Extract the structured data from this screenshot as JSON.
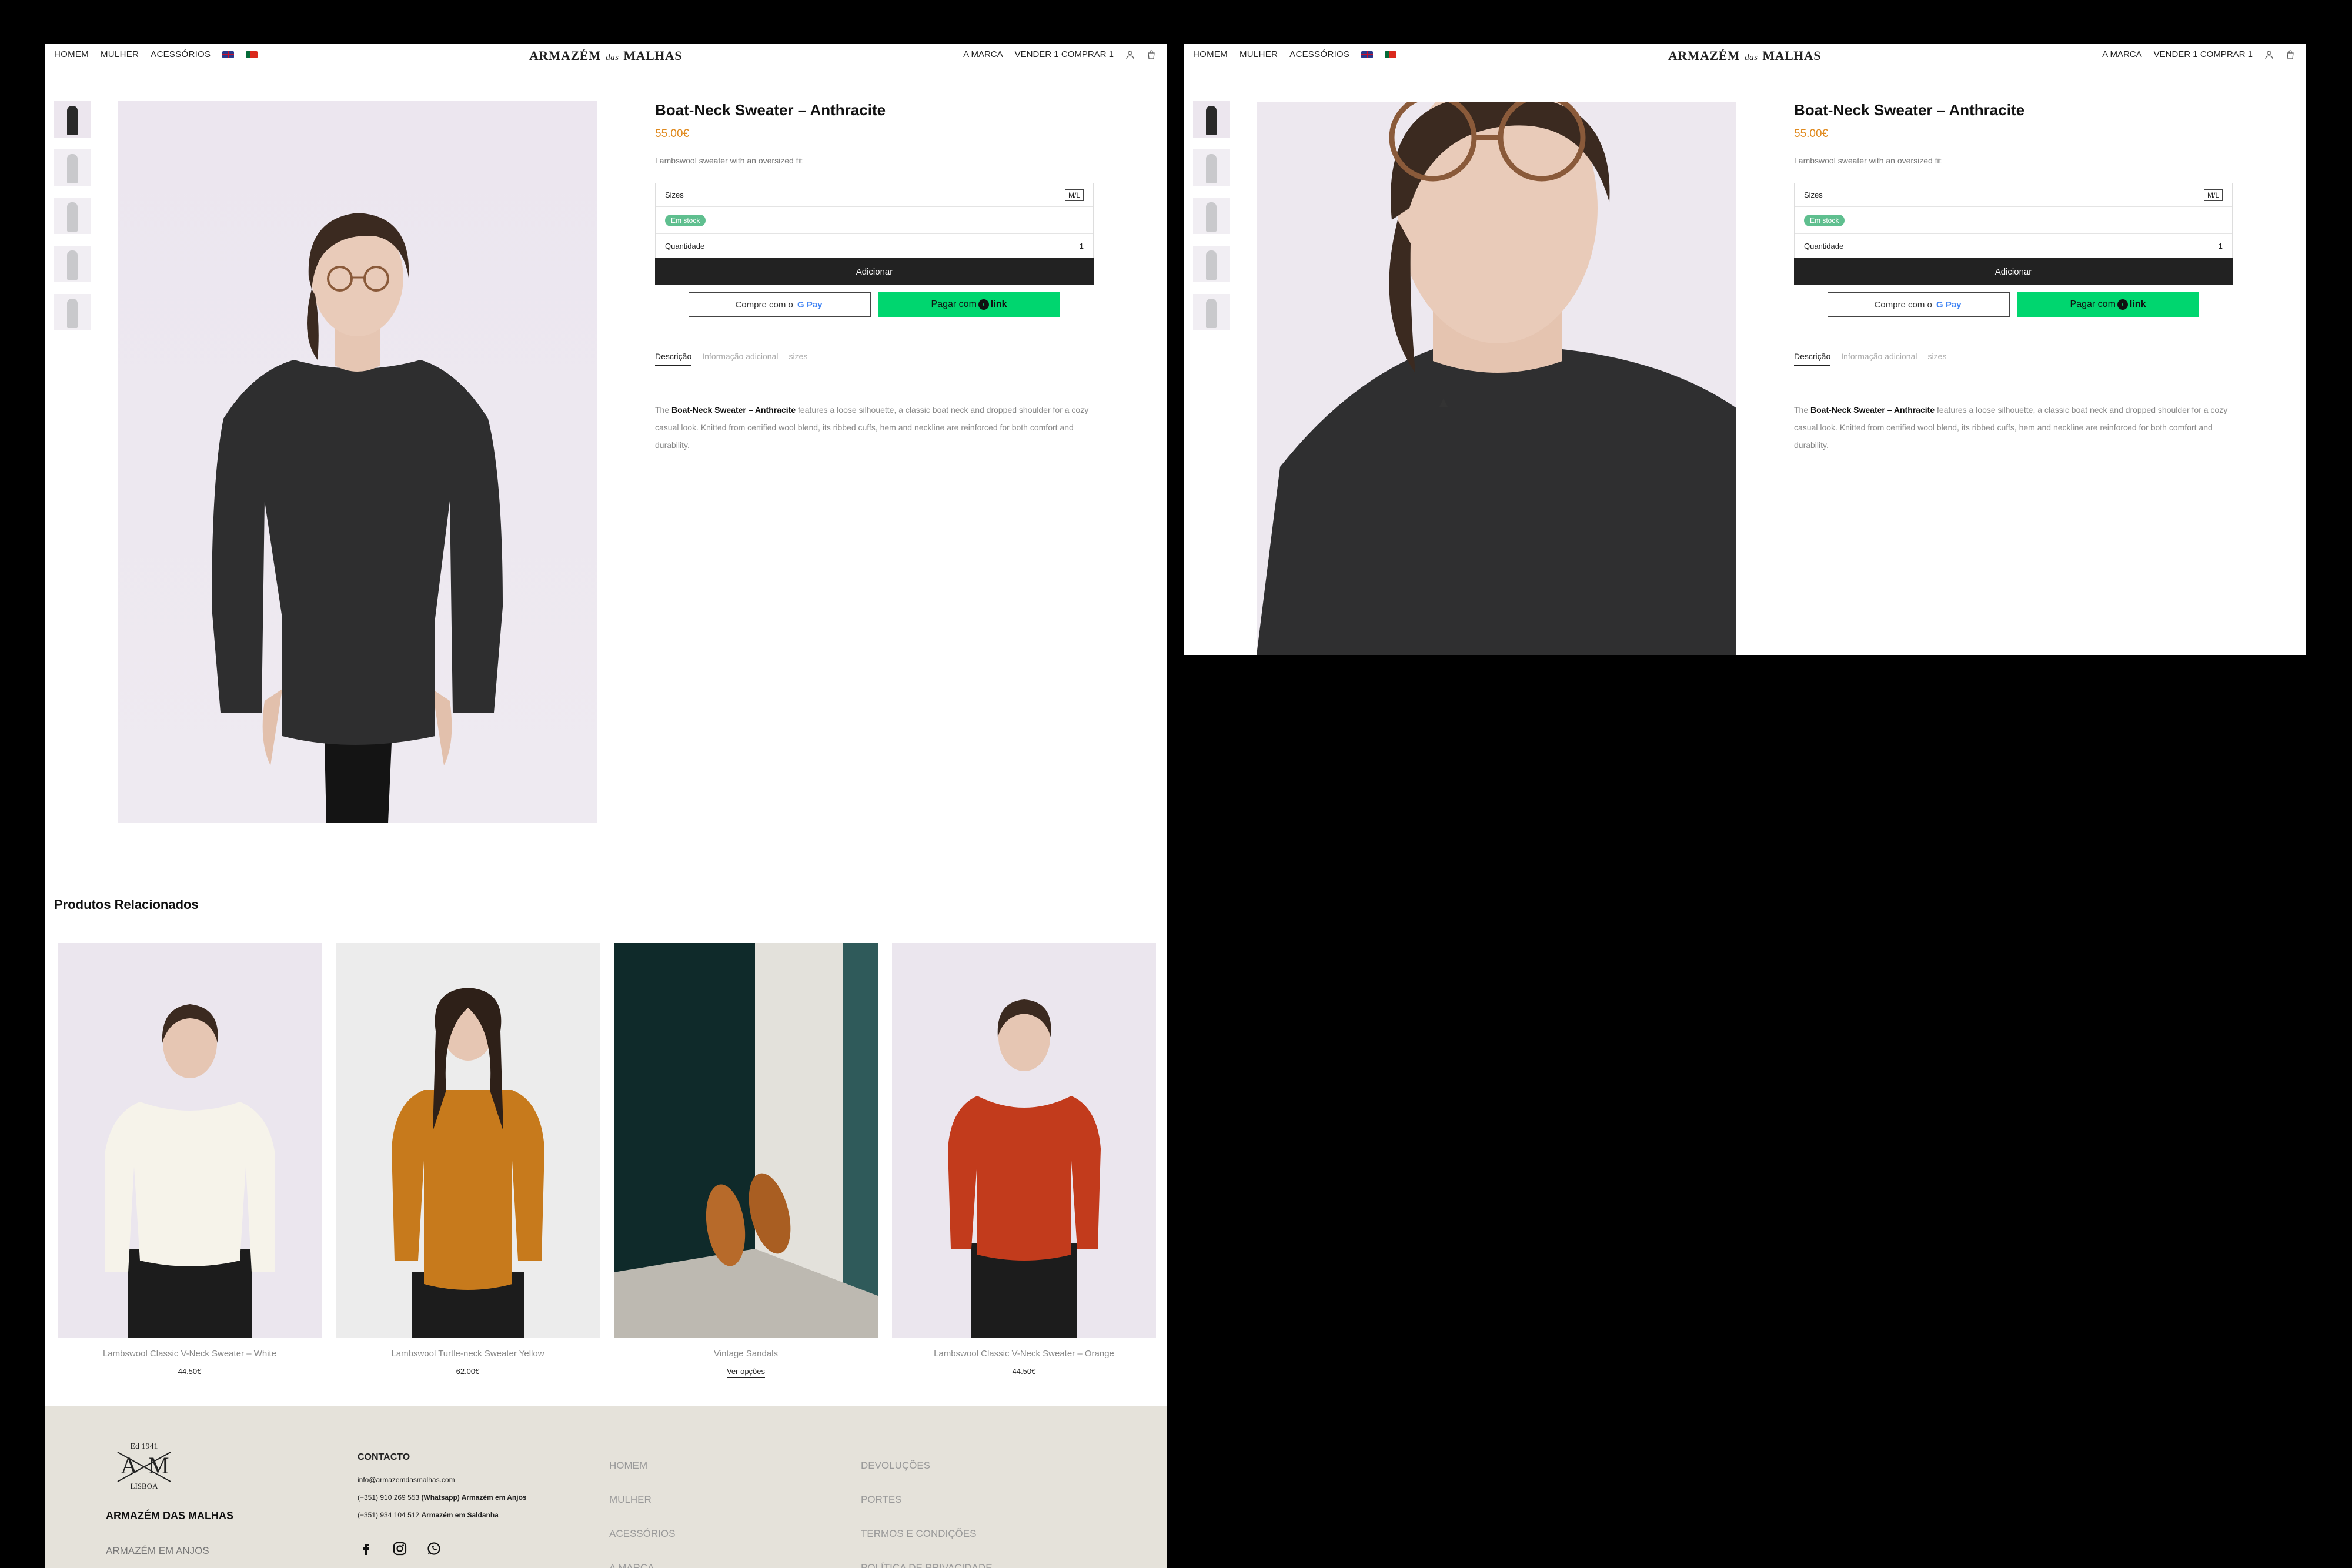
{
  "nav": {
    "left": [
      "HOMEM",
      "MULHER",
      "ACESSÓRIOS"
    ],
    "logo_main": "ARMAZÉM",
    "logo_das": "das",
    "logo_end": "MALHAS",
    "right_brand": "A MARCA",
    "right_promo": "VENDER 1 COMPRAR 1"
  },
  "product": {
    "title": "Boat-Neck Sweater – Anthracite",
    "price": "55.00€",
    "short_desc": "Lambswool sweater with an oversized fit",
    "sizes_label": "Sizes",
    "size_value": "M/L",
    "stock": "Em stock",
    "qty_label": "Quantidade",
    "qty_value": "1",
    "add_button": "Adicionar",
    "gpay_label": "Compre com o",
    "gpay_brand": "G Pay",
    "link_label": "Pagar com",
    "link_brand": "link",
    "tabs": [
      "Descrição",
      "Informação adicional",
      "sizes"
    ],
    "desc_prefix": "The",
    "desc_bold": "Boat-Neck Sweater – Anthracite",
    "desc_rest": "features a loose silhouette, a classic boat neck and dropped shoulder for a cozy casual look. Knitted from certified wool blend, its ribbed cuffs, hem and neckline are reinforced for both comfort and durability."
  },
  "related": {
    "heading": "Produtos Relacionados",
    "items": [
      {
        "name": "Lambswool Classic V-Neck Sweater – White",
        "price": "44.50€",
        "color": "#f6f3ea"
      },
      {
        "name": "Lambswool Turtle-neck Sweater Yellow",
        "price": "62.00€",
        "color": "#c77a1c"
      },
      {
        "name": "Vintage Sandals",
        "price": "Ver opções",
        "color": "#b76a2a"
      },
      {
        "name": "Lambswool Classic V-Neck Sweater – Orange",
        "price": "44.50€",
        "color": "#c23b1c"
      }
    ]
  },
  "footer": {
    "logo_text": "Ed 1941",
    "logo_sub": "LISBOA",
    "brand": "ARMAZÉM DAS MALHAS",
    "sub": "ARMAZÉM EM ANJOS",
    "contact_title": "CONTACTO",
    "email": "info@armazemdasmalhas.com",
    "phone1": "(+351) 910 269 553",
    "phone1_note": "(Whatsapp) Armazém em Anjos",
    "phone2": "(+351) 934 104 512",
    "phone2_note": "Armazém em Saldanha",
    "col1": [
      "HOMEM",
      "MULHER",
      "ACESSÓRIOS",
      "A MARCA"
    ],
    "col2": [
      "DEVOLUÇÕES",
      "PORTES",
      "TERMOS E CONDIÇÕES",
      "POLÍTICA DE PRIVACIDADE"
    ]
  }
}
